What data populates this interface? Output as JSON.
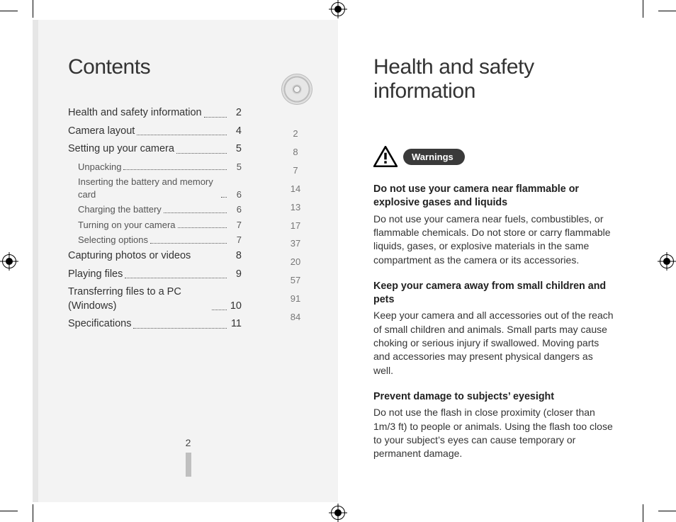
{
  "left_page": {
    "title": "Contents",
    "toc": [
      {
        "label": "Health and safety information",
        "page": "2",
        "side": "2"
      },
      {
        "label": "Camera layout",
        "page": "4",
        "side": "8"
      },
      {
        "label": "Setting up your camera",
        "page": "5",
        "side": "",
        "children": [
          {
            "label": "Unpacking",
            "page": "5",
            "side": "7"
          },
          {
            "label": "Inserting the battery and memory card",
            "page": "6",
            "side": "14"
          },
          {
            "label": "Charging the battery",
            "page": "6",
            "side": "13"
          },
          {
            "label": "Turning on your camera",
            "page": "7",
            "side": "17"
          },
          {
            "label": "Selecting options",
            "page": "7",
            "side": "37"
          }
        ]
      },
      {
        "label": "Capturing photos or videos",
        "page": "8",
        "side": "20"
      },
      {
        "label": "Playing files",
        "page": "9",
        "side": "57"
      },
      {
        "label": "Transferring files to a PC (Windows)",
        "page": "10",
        "side": "91"
      },
      {
        "label": "Specifications",
        "page": "11",
        "side": "84"
      }
    ],
    "side_numbers": [
      "2",
      "8",
      "",
      "7",
      "",
      "14",
      "13",
      "17",
      "37",
      "20",
      "57",
      "",
      "91",
      "84"
    ],
    "footer_page_number": "2"
  },
  "right_page": {
    "title": "Health and safety information",
    "warning_label": "Warnings",
    "blocks": [
      {
        "title": "Do not use your camera near flammable or explosive gases and liquids",
        "body": "Do not use your camera near fuels, combustibles, or flammable chemicals. Do not store or carry flammable liquids, gases, or explosive materials in the same compartment as the camera or its accessories."
      },
      {
        "title": "Keep your camera away from small children and pets",
        "body": "Keep your camera and all accessories out of the reach of small children and animals. Small parts may cause choking or serious injury if swallowed. Moving parts and accessories may present physical dangers as well."
      },
      {
        "title": "Prevent damage to subjects’ eyesight",
        "body": "Do not use the flash in close proximity (closer than 1m/3 ft) to people or animals. Using the flash too close to your subject’s eyes can cause temporary or permanent damage."
      }
    ]
  }
}
